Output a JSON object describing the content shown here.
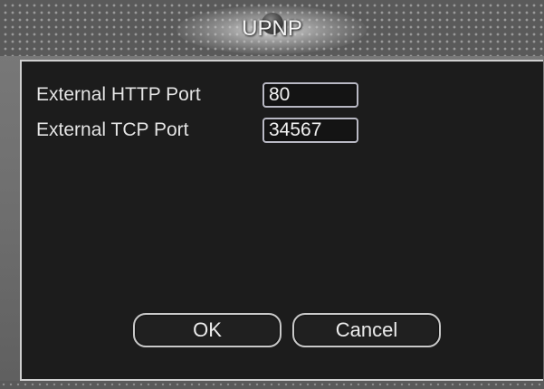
{
  "dialog": {
    "title": "UPNP"
  },
  "fields": [
    {
      "label": "External HTTP Port",
      "value": "80"
    },
    {
      "label": "External TCP Port",
      "value": "34567"
    }
  ],
  "buttons": {
    "ok_label": "OK",
    "cancel_label": "Cancel"
  },
  "colors": {
    "panel_background": "#1c1c1c",
    "frame": "#6e6e6e",
    "text": "#e6e6e6"
  }
}
